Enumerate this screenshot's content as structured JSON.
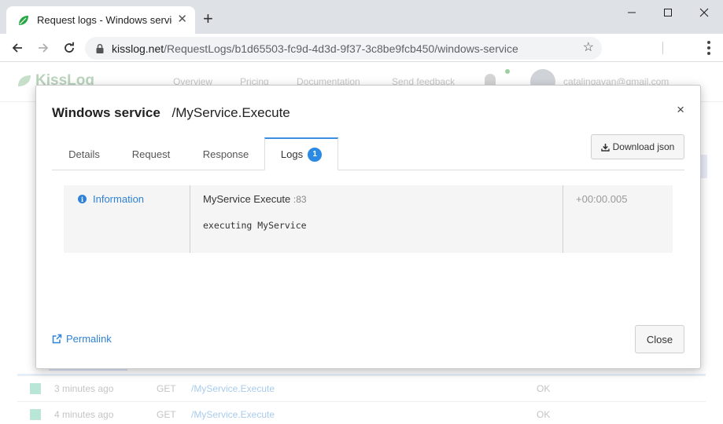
{
  "browser": {
    "tab_title": "Request logs - Windows service |",
    "url_host": "kisslog.net",
    "url_path": "/RequestLogs/b1d65503-fc9d-4d3d-9f37-3c8be9fcb450/windows-service"
  },
  "site": {
    "brand": "KissLog",
    "nav": [
      "Overview",
      "Pricing",
      "Documentation",
      "Send feedback"
    ],
    "user_email": "catalingavan@gmail.com",
    "rows": [
      {
        "time": "3 minutes ago",
        "method": "GET",
        "url": "/MyService.Execute",
        "status": "OK"
      },
      {
        "time": "4 minutes ago",
        "method": "GET",
        "url": "/MyService.Execute",
        "status": "OK"
      }
    ]
  },
  "modal": {
    "app_name": "Windows service",
    "request_path": "/MyService.Execute",
    "close_x": "×",
    "tabs": {
      "details": "Details",
      "request": "Request",
      "response": "Response",
      "logs": "Logs",
      "logs_count": "1"
    },
    "download_label": "Download json",
    "log": {
      "level": "Information",
      "source": "MyService Execute",
      "line": ":83",
      "message": "executing MyService",
      "timestamp": "+00:00.005"
    },
    "permalink_label": "Permalink",
    "close_label": "Close"
  },
  "colors": {
    "accent": "#2f82d8",
    "badge": "#2b8ae3",
    "active_tab_border": "#3b8fe3"
  }
}
